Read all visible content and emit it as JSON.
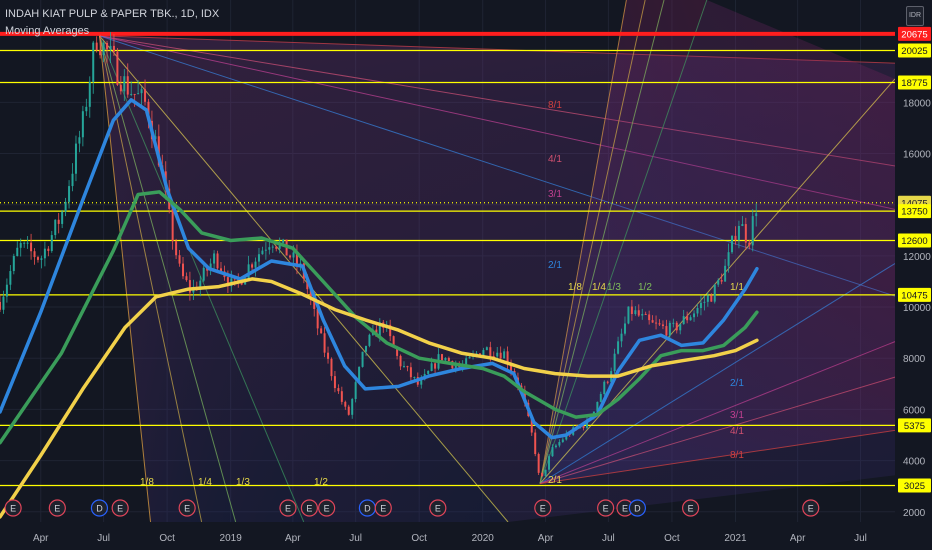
{
  "header": {
    "title": "INDAH KIAT PULP & PAPER TBK., 1D, IDX",
    "indicator": "Moving Averages",
    "currency": "IDR"
  },
  "colors": {
    "background": "#131722",
    "axis_text": "#b2b5be",
    "price_line": "#ffff00",
    "top_line": "#ff1e1e",
    "ma_fast": "#2e86de",
    "ma_mid": "#3a9d5a",
    "ma_slow": "#f2d14a",
    "candle_up": "#26a69a",
    "candle_down": "#ef5350",
    "event_dividend": "#2962ff",
    "event_earnings": "#e0455a"
  },
  "chart_data": {
    "type": "line",
    "title": "INDAH KIAT PULP & PAPER TBK., 1D, IDX",
    "y_axis": {
      "ticks": [
        2000,
        4000,
        6000,
        8000,
        10000,
        12000,
        14000,
        16000,
        18000
      ],
      "tick_labels": [
        "2000",
        "4000",
        "6000",
        "8000",
        "10000",
        "12000",
        "",
        "16000",
        "18000"
      ],
      "range": [
        1600,
        22000
      ]
    },
    "x_axis": {
      "tick_labels": [
        "Apr",
        "Jul",
        "Oct",
        "2019",
        "Apr",
        "Jul",
        "Oct",
        "2020",
        "Apr",
        "Jul",
        "Oct",
        "2021",
        "Apr",
        "Jul"
      ],
      "range": [
        "2018-02-01",
        "2021-08-20"
      ]
    },
    "price_levels": [
      {
        "label": "20675",
        "value": 20675,
        "color": "#ff1e1e"
      },
      {
        "label": "20025",
        "value": 20025,
        "color": "#ffff00"
      },
      {
        "label": "18775",
        "value": 18775,
        "color": "#ffff00"
      },
      {
        "label": "14075",
        "value": 14075,
        "color": "#ffff00",
        "dotted": true
      },
      {
        "label": "13750",
        "value": 13750,
        "color": "#ffff00"
      },
      {
        "label": "12600",
        "value": 12600,
        "color": "#ffff00"
      },
      {
        "label": "10475",
        "value": 10475,
        "color": "#ffff00"
      },
      {
        "label": "5375",
        "value": 5375,
        "color": "#ffff00"
      },
      {
        "label": "3025",
        "value": 3025,
        "color": "#ffff00"
      }
    ],
    "price": {
      "name": "Price",
      "dates": [
        "2018-02-01",
        "2018-03-01",
        "2018-04-01",
        "2018-05-01",
        "2018-06-01",
        "2018-06-20",
        "2018-07-10",
        "2018-08-01",
        "2018-09-01",
        "2018-09-20",
        "2018-10-05",
        "2018-10-20",
        "2018-11-05",
        "2018-11-20",
        "2018-12-10",
        "2019-01-05",
        "2019-02-01",
        "2019-03-01",
        "2019-03-25",
        "2019-04-15",
        "2019-05-10",
        "2019-06-01",
        "2019-06-20",
        "2019-07-15",
        "2019-08-10",
        "2019-09-01",
        "2019-10-01",
        "2019-11-01",
        "2019-12-01",
        "2020-01-01",
        "2020-02-01",
        "2020-02-25",
        "2020-03-15",
        "2020-03-24",
        "2020-04-10",
        "2020-05-01",
        "2020-06-01",
        "2020-07-01",
        "2020-08-01",
        "2020-09-01",
        "2020-10-01",
        "2020-11-01",
        "2020-12-01",
        "2020-12-20",
        "2021-01-05",
        "2021-01-20",
        "2021-02-01"
      ],
      "values": [
        10200,
        12400,
        11900,
        13600,
        17200,
        20600,
        19800,
        18700,
        17900,
        15800,
        13300,
        11300,
        10600,
        11100,
        12000,
        10700,
        11800,
        12700,
        12100,
        11400,
        8900,
        7000,
        5700,
        8500,
        9400,
        7900,
        6900,
        8100,
        7600,
        8400,
        8200,
        6800,
        4700,
        3100,
        4400,
        5000,
        5500,
        7300,
        9900,
        9300,
        9100,
        9800,
        10600,
        11700,
        13400,
        12600,
        14075
      ]
    },
    "series": [
      {
        "name": "MA fast",
        "dates": [
          "2018-02-01",
          "2018-04-01",
          "2018-06-01",
          "2018-07-15",
          "2018-08-10",
          "2018-09-01",
          "2018-10-01",
          "2018-11-01",
          "2018-12-01",
          "2019-01-15",
          "2019-03-01",
          "2019-04-15",
          "2019-05-15",
          "2019-06-15",
          "2019-07-15",
          "2019-09-01",
          "2019-10-15",
          "2019-12-01",
          "2020-01-15",
          "2020-02-15",
          "2020-03-15",
          "2020-04-10",
          "2020-05-01",
          "2020-06-15",
          "2020-07-15",
          "2020-08-15",
          "2020-09-15",
          "2020-10-15",
          "2020-11-15",
          "2020-12-15",
          "2021-01-15",
          "2021-02-01"
        ],
        "values": [
          5900,
          9800,
          14200,
          17300,
          18100,
          17700,
          14600,
          12300,
          11500,
          11100,
          11800,
          11600,
          9500,
          7700,
          6800,
          6900,
          7300,
          7600,
          7800,
          7400,
          5500,
          4900,
          5000,
          5800,
          7500,
          8700,
          8900,
          8500,
          8600,
          9500,
          10700,
          11500
        ]
      },
      {
        "name": "MA mid",
        "dates": [
          "2018-02-01",
          "2018-05-01",
          "2018-07-15",
          "2018-08-20",
          "2018-09-20",
          "2018-10-20",
          "2018-11-20",
          "2019-01-01",
          "2019-02-15",
          "2019-04-01",
          "2019-05-15",
          "2019-07-01",
          "2019-08-15",
          "2019-10-01",
          "2019-11-15",
          "2020-01-01",
          "2020-02-01",
          "2020-03-01",
          "2020-04-15",
          "2020-05-15",
          "2020-06-15",
          "2020-07-15",
          "2020-08-15",
          "2020-09-15",
          "2020-10-15",
          "2020-11-15",
          "2020-12-15",
          "2021-01-15",
          "2021-02-01"
        ],
        "values": [
          4700,
          8200,
          12200,
          14400,
          14500,
          13800,
          12900,
          12600,
          12700,
          12300,
          11000,
          9600,
          8600,
          8000,
          7800,
          7600,
          7300,
          6700,
          6000,
          5700,
          5800,
          6400,
          7200,
          8100,
          8300,
          8300,
          8500,
          9200,
          9800
        ]
      },
      {
        "name": "MA slow",
        "dates": [
          "2018-02-01",
          "2018-04-01",
          "2018-06-01",
          "2018-08-01",
          "2018-09-15",
          "2018-11-01",
          "2018-12-15",
          "2019-02-01",
          "2019-03-01",
          "2019-04-15",
          "2019-06-01",
          "2019-07-15",
          "2019-09-01",
          "2019-10-15",
          "2019-12-01",
          "2020-01-15",
          "2020-03-01",
          "2020-04-15",
          "2020-06-01",
          "2020-07-15",
          "2020-09-01",
          "2020-10-15",
          "2020-12-01",
          "2021-01-01",
          "2021-02-01"
        ],
        "values": [
          1800,
          4200,
          6800,
          9200,
          10400,
          10700,
          10800,
          11100,
          11000,
          10500,
          9900,
          9500,
          9100,
          8600,
          8200,
          8000,
          7600,
          7400,
          7300,
          7300,
          7700,
          7900,
          8100,
          8300,
          8700
        ]
      }
    ],
    "gann_fans": [
      {
        "origin": {
          "date": "2018-06-25",
          "value": 20600
        },
        "line_labels": [
          "8/1",
          "4/1",
          "3/1",
          "2/1",
          "1/1",
          "1/2",
          "1/3",
          "1/4",
          "1/8"
        ],
        "labels": [
          "1/8",
          "1/4",
          "1/3",
          "1/2"
        ]
      },
      {
        "origin": {
          "date": "2020-03-24",
          "value": 3100
        },
        "line_labels": [
          "1/8",
          "1/4",
          "1/3",
          "1/2",
          "1/1",
          "2/1",
          "3/1",
          "4/1",
          "8/1"
        ],
        "labels": [
          "1/8",
          "1/4",
          "1/3",
          "1/2",
          "1/1",
          "2/1",
          "3/1",
          "4/1",
          "8/1",
          "2/1",
          "8/1",
          "4/1",
          "3/1",
          "2/1"
        ]
      }
    ],
    "events": [
      {
        "type": "E",
        "date": "2018-02-20"
      },
      {
        "type": "E",
        "date": "2018-04-25"
      },
      {
        "type": "D",
        "date": "2018-06-25"
      },
      {
        "type": "E",
        "date": "2018-07-25"
      },
      {
        "type": "E",
        "date": "2018-10-30"
      },
      {
        "type": "E",
        "date": "2019-03-25"
      },
      {
        "type": "E",
        "date": "2019-04-25"
      },
      {
        "type": "E",
        "date": "2019-05-20"
      },
      {
        "type": "D",
        "date": "2019-07-18"
      },
      {
        "type": "E",
        "date": "2019-08-10"
      },
      {
        "type": "E",
        "date": "2019-10-28"
      },
      {
        "type": "E",
        "date": "2020-03-28"
      },
      {
        "type": "E",
        "date": "2020-06-27"
      },
      {
        "type": "E",
        "date": "2020-07-25"
      },
      {
        "type": "D",
        "date": "2020-08-12"
      },
      {
        "type": "E",
        "date": "2020-10-28"
      },
      {
        "type": "E",
        "date": "2021-04-20"
      }
    ]
  }
}
